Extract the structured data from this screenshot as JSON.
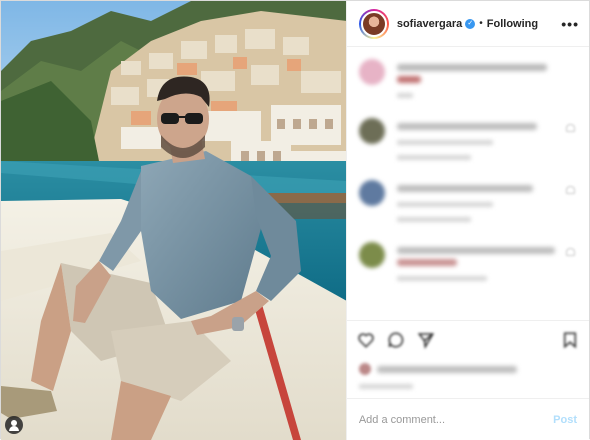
{
  "header": {
    "username": "sofiavergara",
    "verified_icon": "verified-badge-icon",
    "separator": "•",
    "follow_status": "Following",
    "more_icon": "more-options-icon",
    "more_label": "•••"
  },
  "photo": {
    "tag_icon": "user-tag-icon"
  },
  "comments": {
    "blurred": true,
    "items": [
      {
        "avatar_color": "#e7b3c6"
      },
      {
        "avatar_color": "#6d6e57"
      },
      {
        "avatar_color": "#5f7aa0"
      },
      {
        "avatar_color": "#7c8c4a"
      }
    ]
  },
  "actions": {
    "icons": [
      "heart-icon",
      "comment-icon",
      "share-icon",
      "bookmark-icon"
    ]
  },
  "comment_box": {
    "placeholder": "Add a comment...",
    "post_label": "Post"
  },
  "colors": {
    "verified": "#3897f0",
    "post_disabled": "#b2dffc",
    "border": "#dbdbdb"
  }
}
